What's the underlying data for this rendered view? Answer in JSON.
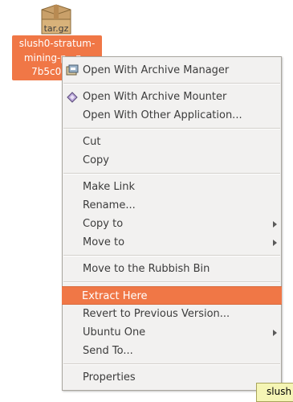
{
  "desktop_file": {
    "icon": "tar-gz-archive-icon",
    "icon_text": "tar.gz",
    "name_lines": [
      "slush0-stratum-",
      "mining-p...z...",
      "7b5c080..."
    ]
  },
  "context_menu": {
    "items": [
      {
        "label": "Open With Archive Manager",
        "icon": "archive-manager-icon"
      },
      {
        "label": "Open With Archive Mounter",
        "icon": "archive-mounter-icon"
      },
      {
        "label": "Open With Other Application..."
      },
      {
        "label": "Cut"
      },
      {
        "label": "Copy"
      },
      {
        "label": "Make Link"
      },
      {
        "label": "Rename..."
      },
      {
        "label": "Copy to",
        "submenu": true
      },
      {
        "label": "Move to",
        "submenu": true
      },
      {
        "label": "Move to the Rubbish Bin"
      },
      {
        "label": "Extract Here",
        "highlighted": true
      },
      {
        "label": "Revert to Previous Version..."
      },
      {
        "label": "Ubuntu One",
        "submenu": true
      },
      {
        "label": "Send To..."
      },
      {
        "label": "Properties"
      }
    ]
  },
  "tooltip": {
    "text": "slush"
  },
  "colors": {
    "highlight": "#f07746",
    "menu_bg": "#f2f1f0"
  }
}
